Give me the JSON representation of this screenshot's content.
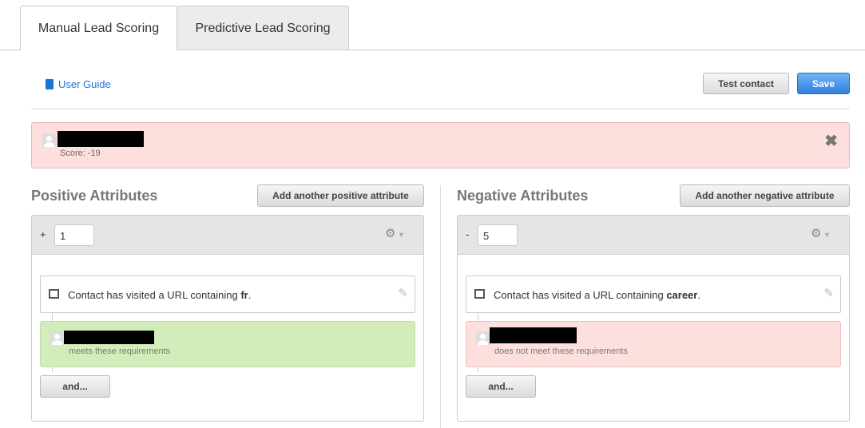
{
  "tabs": [
    {
      "label": "Manual Lead Scoring",
      "active": true
    },
    {
      "label": "Predictive Lead Scoring",
      "active": false
    }
  ],
  "toolbar": {
    "user_guide": "User Guide",
    "test_contact": "Test contact",
    "save": "Save"
  },
  "test_result": {
    "score": "Score: -19",
    "status": "negative"
  },
  "positive": {
    "title": "Positive Attributes",
    "add": "Add another positive attribute",
    "sign": "+",
    "value": "1",
    "condition_prefix": "Contact has visited a URL containing ",
    "condition_value": "fr",
    "condition_suffix": ".",
    "result": "meets these requirements",
    "and": "and..."
  },
  "negative": {
    "title": "Negative Attributes",
    "add": "Add another negative attribute",
    "sign": "-",
    "value": "5",
    "condition_prefix": "Contact has visited a URL containing ",
    "condition_value": "career",
    "condition_suffix": ".",
    "result": "does not meet these requirements",
    "and": "and..."
  },
  "colors": {
    "accent": "#1a73d6",
    "negative_bg": "#fde0de",
    "positive_bg": "#d2edb9"
  }
}
